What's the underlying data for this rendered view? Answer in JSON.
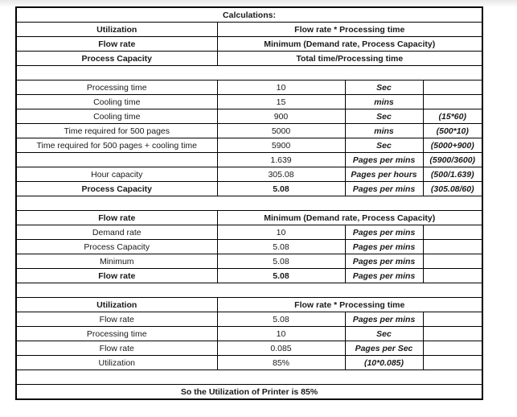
{
  "sheet": {
    "title": "Calculations:",
    "definitions": [
      {
        "term": "Utilization",
        "formula": "Flow rate * Processing time"
      },
      {
        "term": "Flow rate",
        "formula": "Minimum (Demand rate, Process Capacity)"
      },
      {
        "term": "Process Capacity",
        "formula": "Total time/Processing time"
      }
    ],
    "capacity_block": [
      {
        "label": "Processing time",
        "value": "10",
        "unit": "Sec",
        "formula": "",
        "bold": false
      },
      {
        "label": "Cooling time",
        "value": "15",
        "unit": "mins",
        "formula": "",
        "bold": false
      },
      {
        "label": "Cooling time",
        "value": "900",
        "unit": "Sec",
        "formula": "(15*60)",
        "bold": false
      },
      {
        "label": "Time required for 500 pages",
        "value": "5000",
        "unit": "mins",
        "formula": "(500*10)",
        "bold": false
      },
      {
        "label": "Time required for 500 pages + cooling time",
        "value": "5900",
        "unit": "Sec",
        "formula": "(5000+900)",
        "bold": false
      },
      {
        "label": "",
        "value": "1.639",
        "unit": "Pages per mins",
        "formula": "(5900/3600)",
        "bold": false
      },
      {
        "label": "Hour capacity",
        "value": "305.08",
        "unit": "Pages per hours",
        "formula": "(500/1.639)",
        "bold": false
      },
      {
        "label": "Process Capacity",
        "value": "5.08",
        "unit": "Pages per mins",
        "formula": "(305.08/60)",
        "bold": true
      }
    ],
    "flow_rate_section": {
      "header_term": "Flow rate",
      "header_formula": "Minimum (Demand rate, Process Capacity)",
      "rows": [
        {
          "label": "Demand rate",
          "value": "10",
          "unit": "Pages per mins",
          "formula": "",
          "bold": false
        },
        {
          "label": "Process Capacity",
          "value": "5.08",
          "unit": "Pages per mins",
          "formula": "",
          "bold": false
        },
        {
          "label": "Minimum",
          "value": "5.08",
          "unit": "Pages per mins",
          "formula": "",
          "bold": false
        },
        {
          "label": "Flow rate",
          "value": "5.08",
          "unit": "Pages per mins",
          "formula": "",
          "bold": true
        }
      ]
    },
    "utilization_section": {
      "header_term": "Utilization",
      "header_formula": "Flow rate * Processing time",
      "rows": [
        {
          "label": "Flow rate",
          "value": "5.08",
          "unit": "Pages per mins",
          "formula": "",
          "bold": false
        },
        {
          "label": "Processing time",
          "value": "10",
          "unit": "Sec",
          "formula": "",
          "bold": false
        },
        {
          "label": "Flow rate",
          "value": "0.085",
          "unit": "Pages per Sec",
          "formula": "",
          "bold": false
        },
        {
          "label": "Utilization",
          "value": "85%",
          "unit": "(10*0.085)",
          "formula": "",
          "bold": false
        }
      ]
    },
    "conclusion": "So the Utilization of Printer is 85%"
  },
  "colors": {
    "red_text": "#ff2b2b",
    "border": "#000000",
    "text": "#1a1a1a"
  }
}
